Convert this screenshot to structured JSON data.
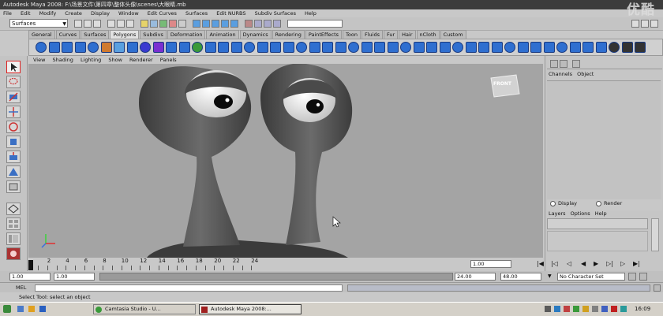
{
  "window": {
    "title": "Autodesk Maya 2008:  F:\\场景文件\\第四章\\整体头像\\scenes\\大眼睛.mb",
    "watermark": "优酷"
  },
  "menu": [
    "File",
    "Edit",
    "Modify",
    "Create",
    "Display",
    "Window",
    "Edit Curves",
    "Surfaces",
    "Edit NURBS",
    "Subdiv Surfaces",
    "Help"
  ],
  "status_line": {
    "mode": "Surfaces"
  },
  "shelf": {
    "tabs": [
      "General",
      "Curves",
      "Surfaces",
      "Polygons",
      "Subdivs",
      "Deformation",
      "Animation",
      "Dynamics",
      "Rendering",
      "PaintEffects",
      "Toon",
      "Fluids",
      "Fur",
      "Hair",
      "nCloth",
      "Custom"
    ],
    "active_tab": "Polygons"
  },
  "viewport": {
    "menu": [
      "View",
      "Shading",
      "Lighting",
      "Show",
      "Renderer",
      "Panels"
    ],
    "view_cube_label": "FRONT"
  },
  "channel_box": {
    "header": [
      "Channels",
      "Object"
    ],
    "layer_tabs": {
      "display": "Display",
      "render": "Render"
    },
    "layer_menu": [
      "Layers",
      "Options",
      "Help"
    ]
  },
  "timeline": {
    "ticks": [
      "2",
      "4",
      "6",
      "8",
      "10",
      "12",
      "14",
      "16",
      "18",
      "20",
      "22",
      "24"
    ],
    "current_time": "1.00"
  },
  "range_slider": {
    "start_time": "1.00",
    "playback_start": "1.00",
    "playback_end": "24.00",
    "end_time": "48.00",
    "character_set": "No Character Set"
  },
  "command_line": {
    "label": "MEL"
  },
  "help_line": {
    "text": "Select Tool: select an object"
  },
  "taskbar": {
    "items": [
      {
        "label": "Camtasia Studio - U...",
        "active": false
      },
      {
        "label": "Autodesk Maya 2008:...",
        "active": true
      }
    ],
    "clock": "16:09"
  }
}
